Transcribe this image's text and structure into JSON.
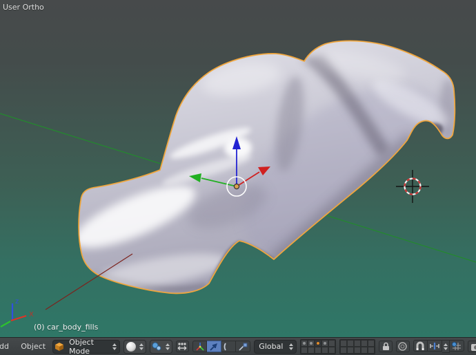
{
  "viewport": {
    "view_label": "User Ortho",
    "object_info": "(0) car_body_fills",
    "axis_gizmo": {
      "z_label": "z",
      "x_label": "X"
    },
    "colors": {
      "background_top": "#474a4b",
      "background_bottom": "#2f7767",
      "selection_outline": "#f0a63d",
      "grid_y_axis_green": "#238a2d",
      "grid_x_axis_red": "#7c231d",
      "manipulator_x_red": "#d02020",
      "manipulator_y_green": "#21b021",
      "manipulator_z_blue": "#2222d2",
      "cursor_red": "#cc3333",
      "body_base": "#c9c8d4"
    }
  },
  "toolbar": {
    "menu_fragment": "dd",
    "object_menu": "Object",
    "mode_dropdown": {
      "value": "Object Mode"
    },
    "orientation_dropdown": {
      "value": "Global"
    },
    "layers": {
      "groups": 2,
      "rows": 2,
      "cols": 5,
      "dots": [
        {
          "index": 0,
          "state": "object"
        },
        {
          "index": 1,
          "state": "object"
        },
        {
          "index": 2,
          "state": "active"
        },
        {
          "index": 3,
          "state": "object"
        }
      ]
    },
    "icons": {
      "mode_icon": "orange-cube",
      "shading_icon": "white-sphere",
      "pivot_icon": "pivot-point-spheres",
      "center_points_icon": "manipulate-center-points",
      "manipulator_axes_icon": "rgb-axis-tripod",
      "translate_icon": "translate-arrow",
      "rotate_icon": "rotate-arc",
      "scale_icon": "scale-square",
      "lock_icon": "lock-to-scene",
      "proportional_icon": "proportional-edit-circle",
      "snap_icon": "magnet",
      "snap_element_icon": "increment-snap",
      "snap_target_icon": "snap-target-ball-grid",
      "render_icon": "opengl-render-camera"
    }
  }
}
